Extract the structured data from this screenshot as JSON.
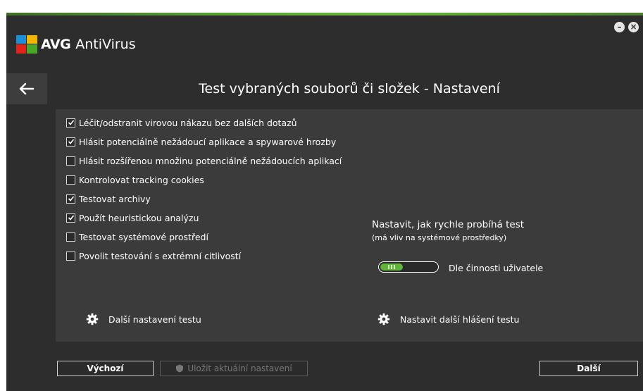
{
  "app": {
    "brand": "AVG",
    "product": "AntiVirus"
  },
  "window_controls": {
    "minimize": "–",
    "close": "×"
  },
  "page": {
    "title": "Test vybraných souborů či složek - Nastavení"
  },
  "options": [
    {
      "label": "Léčit/odstranit virovou nákazu bez dalších dotazů",
      "checked": true
    },
    {
      "label": "Hlásit potenciálně nežádoucí aplikace a spywarové hrozby",
      "checked": true
    },
    {
      "label": "Hlásit rozšířenou množinu potenciálně nežádoucích aplikací",
      "checked": false
    },
    {
      "label": "Kontrolovat tracking cookies",
      "checked": false
    },
    {
      "label": "Testovat archivy",
      "checked": true
    },
    {
      "label": "Použít heuristickou analýzu",
      "checked": true
    },
    {
      "label": "Testovat systémové prostředí",
      "checked": false
    },
    {
      "label": "Povolit testování s extrémní citlivostí",
      "checked": false
    }
  ],
  "speed": {
    "title": "Nastavit, jak rychle probíhá test",
    "subtitle": "(má vliv na systémové prostředky)",
    "value_label": "Dle činnosti uživatele",
    "level": 0.4
  },
  "links": {
    "more_settings": "Další nastavení testu",
    "more_reports": "Nastavit další hlášení testu"
  },
  "buttons": {
    "default": "Výchozí",
    "save": "Uložit aktuální nastavení",
    "next": "Další"
  },
  "colors": {
    "accent": "#5fb43a",
    "background": "#2d2d2d",
    "panel": "#3b3b3b"
  }
}
